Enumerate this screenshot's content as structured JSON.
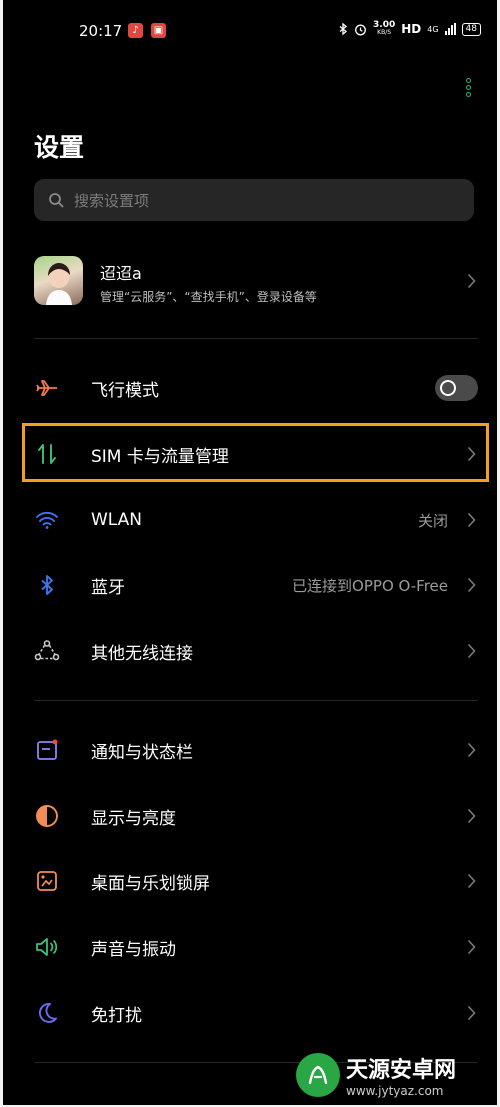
{
  "status_bar": {
    "time": "20:17",
    "speed_value": "3.00",
    "speed_unit": "KB/S",
    "hd": "HD",
    "network": "4G",
    "battery": "48"
  },
  "page": {
    "title": "设置"
  },
  "search": {
    "placeholder": "搜索设置项"
  },
  "account": {
    "name": "迢迢a",
    "subtitle": "管理“云服务”、“查找手机”、登录设备等"
  },
  "items": [
    {
      "label": "飞行模式",
      "value": "",
      "icon": "airplane-icon",
      "toggle": false
    },
    {
      "label": "SIM 卡与流量管理",
      "value": "",
      "icon": "sim-data-icon"
    },
    {
      "label": "WLAN",
      "value": "关闭",
      "icon": "wifi-icon"
    },
    {
      "label": "蓝牙",
      "value": "已连接到OPPO O-Free",
      "icon": "bluetooth-icon"
    },
    {
      "label": "其他无线连接",
      "value": "",
      "icon": "wireless-connect-icon"
    },
    {
      "label": "通知与状态栏",
      "value": "",
      "icon": "notification-icon"
    },
    {
      "label": "显示与亮度",
      "value": "",
      "icon": "display-icon"
    },
    {
      "label": "桌面与乐划锁屏",
      "value": "",
      "icon": "desktop-lockscreen-icon"
    },
    {
      "label": "声音与振动",
      "value": "",
      "icon": "sound-icon"
    },
    {
      "label": "免打扰",
      "value": "",
      "icon": "moon-icon"
    }
  ],
  "watermark": {
    "title": "天源安卓网",
    "url": "www.jytyaz.com"
  },
  "colors": {
    "highlight": "#f3a11d",
    "accent_green": "#2fb573"
  }
}
